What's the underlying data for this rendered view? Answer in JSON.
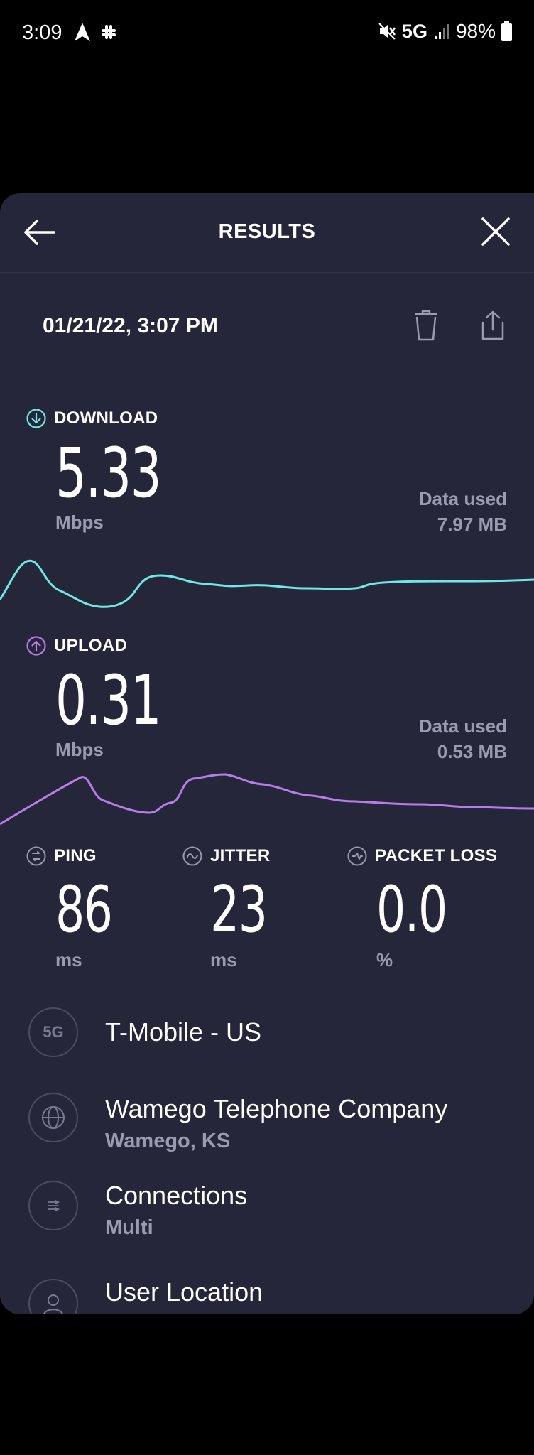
{
  "status_bar": {
    "time": "3:09",
    "network": "5G",
    "battery": "98%"
  },
  "header": {
    "title": "RESULTS"
  },
  "result": {
    "date": "01/21/22, 3:07 PM"
  },
  "download": {
    "label": "DOWNLOAD",
    "value": "5.33",
    "unit": "Mbps",
    "data_used_label": "Data used",
    "data_used_value": "7.97 MB",
    "color": "#6fe8df"
  },
  "upload": {
    "label": "UPLOAD",
    "value": "0.31",
    "unit": "Mbps",
    "data_used_label": "Data used",
    "data_used_value": "0.53 MB",
    "color": "#b77ce8"
  },
  "ping": {
    "label": "PING",
    "value": "86",
    "unit": "ms"
  },
  "jitter": {
    "label": "JITTER",
    "value": "23",
    "unit": "ms"
  },
  "packet_loss": {
    "label": "PACKET LOSS",
    "value": "0.0",
    "unit": "%"
  },
  "rows": {
    "carrier": {
      "icon_text": "5G",
      "title": "T-Mobile - US"
    },
    "server": {
      "title": "Wamego Telephone Company",
      "subtitle": "Wamego, KS"
    },
    "connections": {
      "title": "Connections",
      "subtitle": "Multi"
    },
    "location": {
      "title": "User Location"
    }
  },
  "colors": {
    "background": "#26263a",
    "download_accent": "#6fe8df",
    "upload_accent": "#b77ce8",
    "muted_text": "#9a9bb1"
  }
}
